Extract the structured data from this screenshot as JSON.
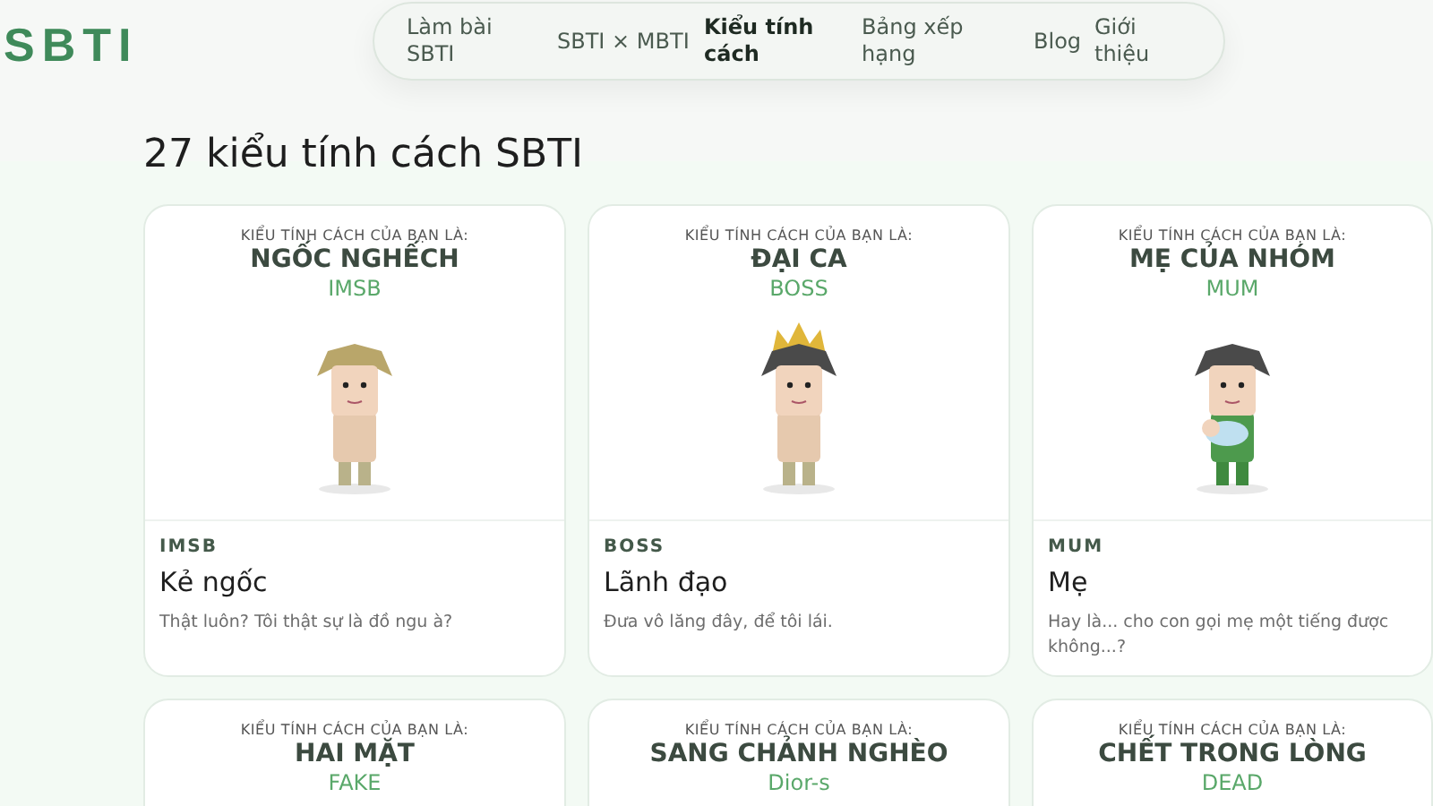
{
  "logo": "SBTI",
  "nav": [
    {
      "label": "Làm bài SBTI",
      "selected": false
    },
    {
      "label": "SBTI × MBTI",
      "selected": false
    },
    {
      "label": "Kiểu tính cách",
      "selected": true
    },
    {
      "label": "Bảng xếp hạng",
      "selected": false
    },
    {
      "label": "Blog",
      "selected": false
    },
    {
      "label": "Giới thiệu",
      "selected": false
    }
  ],
  "heading": "27 kiểu tính cách SBTI",
  "cards": [
    {
      "poster": {
        "label": "KIỂU TÍNH CÁCH CỦA BẠN LÀ:",
        "title": "NGỐC NGHẾCH",
        "code": "IMSB",
        "kind": "plain"
      },
      "code": "IMSB",
      "name": "Kẻ ngốc",
      "quote": "Thật luôn? Tôi thật sự là đồ ngu à?"
    },
    {
      "poster": {
        "label": "KIỂU TÍNH CÁCH CỦA BẠN LÀ:",
        "title": "ĐẠI CA",
        "code": "BOSS",
        "kind": "crown"
      },
      "code": "BOSS",
      "name": "Lãnh đạo",
      "quote": "Đưa vô lăng đây, để tôi lái."
    },
    {
      "poster": {
        "label": "KIỂU TÍNH CÁCH CỦA BẠN LÀ:",
        "title": "MẸ CỦA NHÓM",
        "code": "MUM",
        "kind": "baby"
      },
      "code": "MUM",
      "name": "Mẹ",
      "quote": "Hay là... cho con gọi mẹ một tiếng được không...?"
    },
    {
      "poster": {
        "label": "KIỂU TÍNH CÁCH CỦA BẠN LÀ:",
        "title": "HAI MẶT",
        "code": "FAKE"
      }
    },
    {
      "poster": {
        "label": "KIỂU TÍNH CÁCH CỦA BẠN LÀ:",
        "title": "SANG CHẢNH NGHÈO",
        "code": "Dior-s"
      }
    },
    {
      "poster": {
        "label": "KIỂU TÍNH CÁCH CỦA BẠN LÀ:",
        "title": "CHẾT TRONG LÒNG",
        "code": "DEAD"
      }
    }
  ]
}
